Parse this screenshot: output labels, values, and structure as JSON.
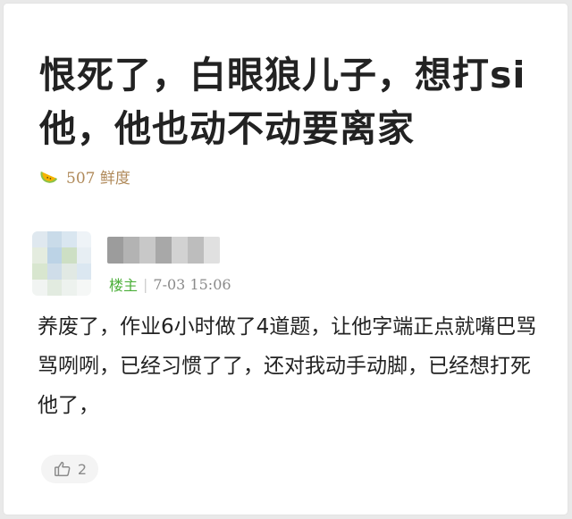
{
  "post": {
    "title": "恨死了，白眼狼儿子，想打si他，他也动不动要离家",
    "freshness": {
      "icon": "melon-slice-icon",
      "text": "507 鲜度",
      "color": "#b08a5a"
    }
  },
  "comment": {
    "author_badge": "楼主",
    "timestamp": "7-03 15:06",
    "body": "养废了，作业6小时做了4道题，让他字端正点就嘴巴骂骂咧咧，已经习惯了了，还对我动手动脚，已经想打死他了，",
    "likes": {
      "icon": "thumbs-up-icon",
      "count": "2"
    }
  },
  "colors": {
    "badge_green": "#4caf3a",
    "meta_gray": "#8a8a8a",
    "text": "#222222"
  }
}
